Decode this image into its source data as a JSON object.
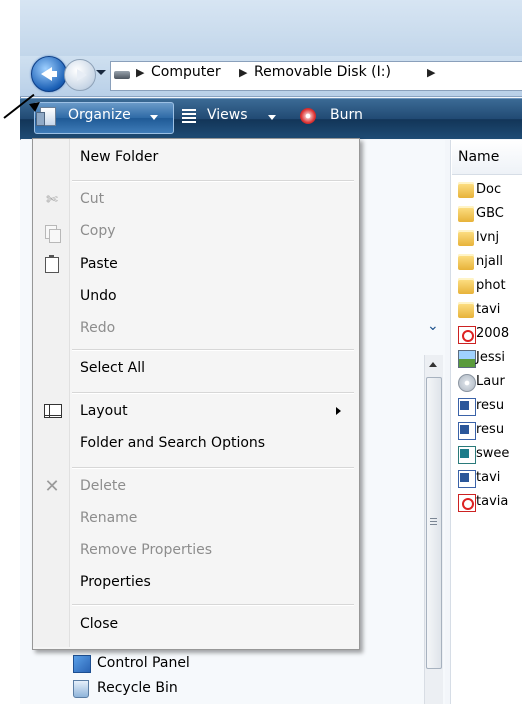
{
  "address": {
    "crumbs": [
      "Computer",
      "Removable Disk (I:)"
    ]
  },
  "toolbar": {
    "organize_label": "Organize",
    "views_label": "Views",
    "burn_label": "Burn"
  },
  "file_list": {
    "column_header": "Name",
    "items": [
      {
        "name": "Doc",
        "icon": "folder-icon"
      },
      {
        "name": "GBC",
        "icon": "folder-icon"
      },
      {
        "name": "lvnj",
        "icon": "folder-icon"
      },
      {
        "name": "njall",
        "icon": "folder-icon"
      },
      {
        "name": "phot",
        "icon": "folder-icon"
      },
      {
        "name": "tavi",
        "icon": "folder-icon"
      },
      {
        "name": "2008",
        "icon": "pdf-icon"
      },
      {
        "name": "Jessi",
        "icon": "image-icon"
      },
      {
        "name": "Laur",
        "icon": "disc-icon"
      },
      {
        "name": "resu",
        "icon": "word-doc-icon"
      },
      {
        "name": "resu",
        "icon": "word-doc-icon"
      },
      {
        "name": "swee",
        "icon": "publisher-icon"
      },
      {
        "name": "tavi",
        "icon": "word-doc-icon"
      },
      {
        "name": "tavia",
        "icon": "pdf-icon"
      }
    ]
  },
  "nav_pane": {
    "control_panel": "Control Panel",
    "recycle_bin": "Recycle Bin"
  },
  "organize_menu": {
    "new_folder": "New Folder",
    "cut": "Cut",
    "copy": "Copy",
    "paste": "Paste",
    "undo": "Undo",
    "redo": "Redo",
    "select_all": "Select All",
    "layout": "Layout",
    "folder_options": "Folder and Search Options",
    "delete": "Delete",
    "rename": "Rename",
    "remove_properties": "Remove Properties",
    "properties": "Properties",
    "close": "Close"
  },
  "colors": {
    "toolbar": "#214a73",
    "menu_background": "#f5f5f5",
    "disabled_text": "#8d8d8d"
  }
}
